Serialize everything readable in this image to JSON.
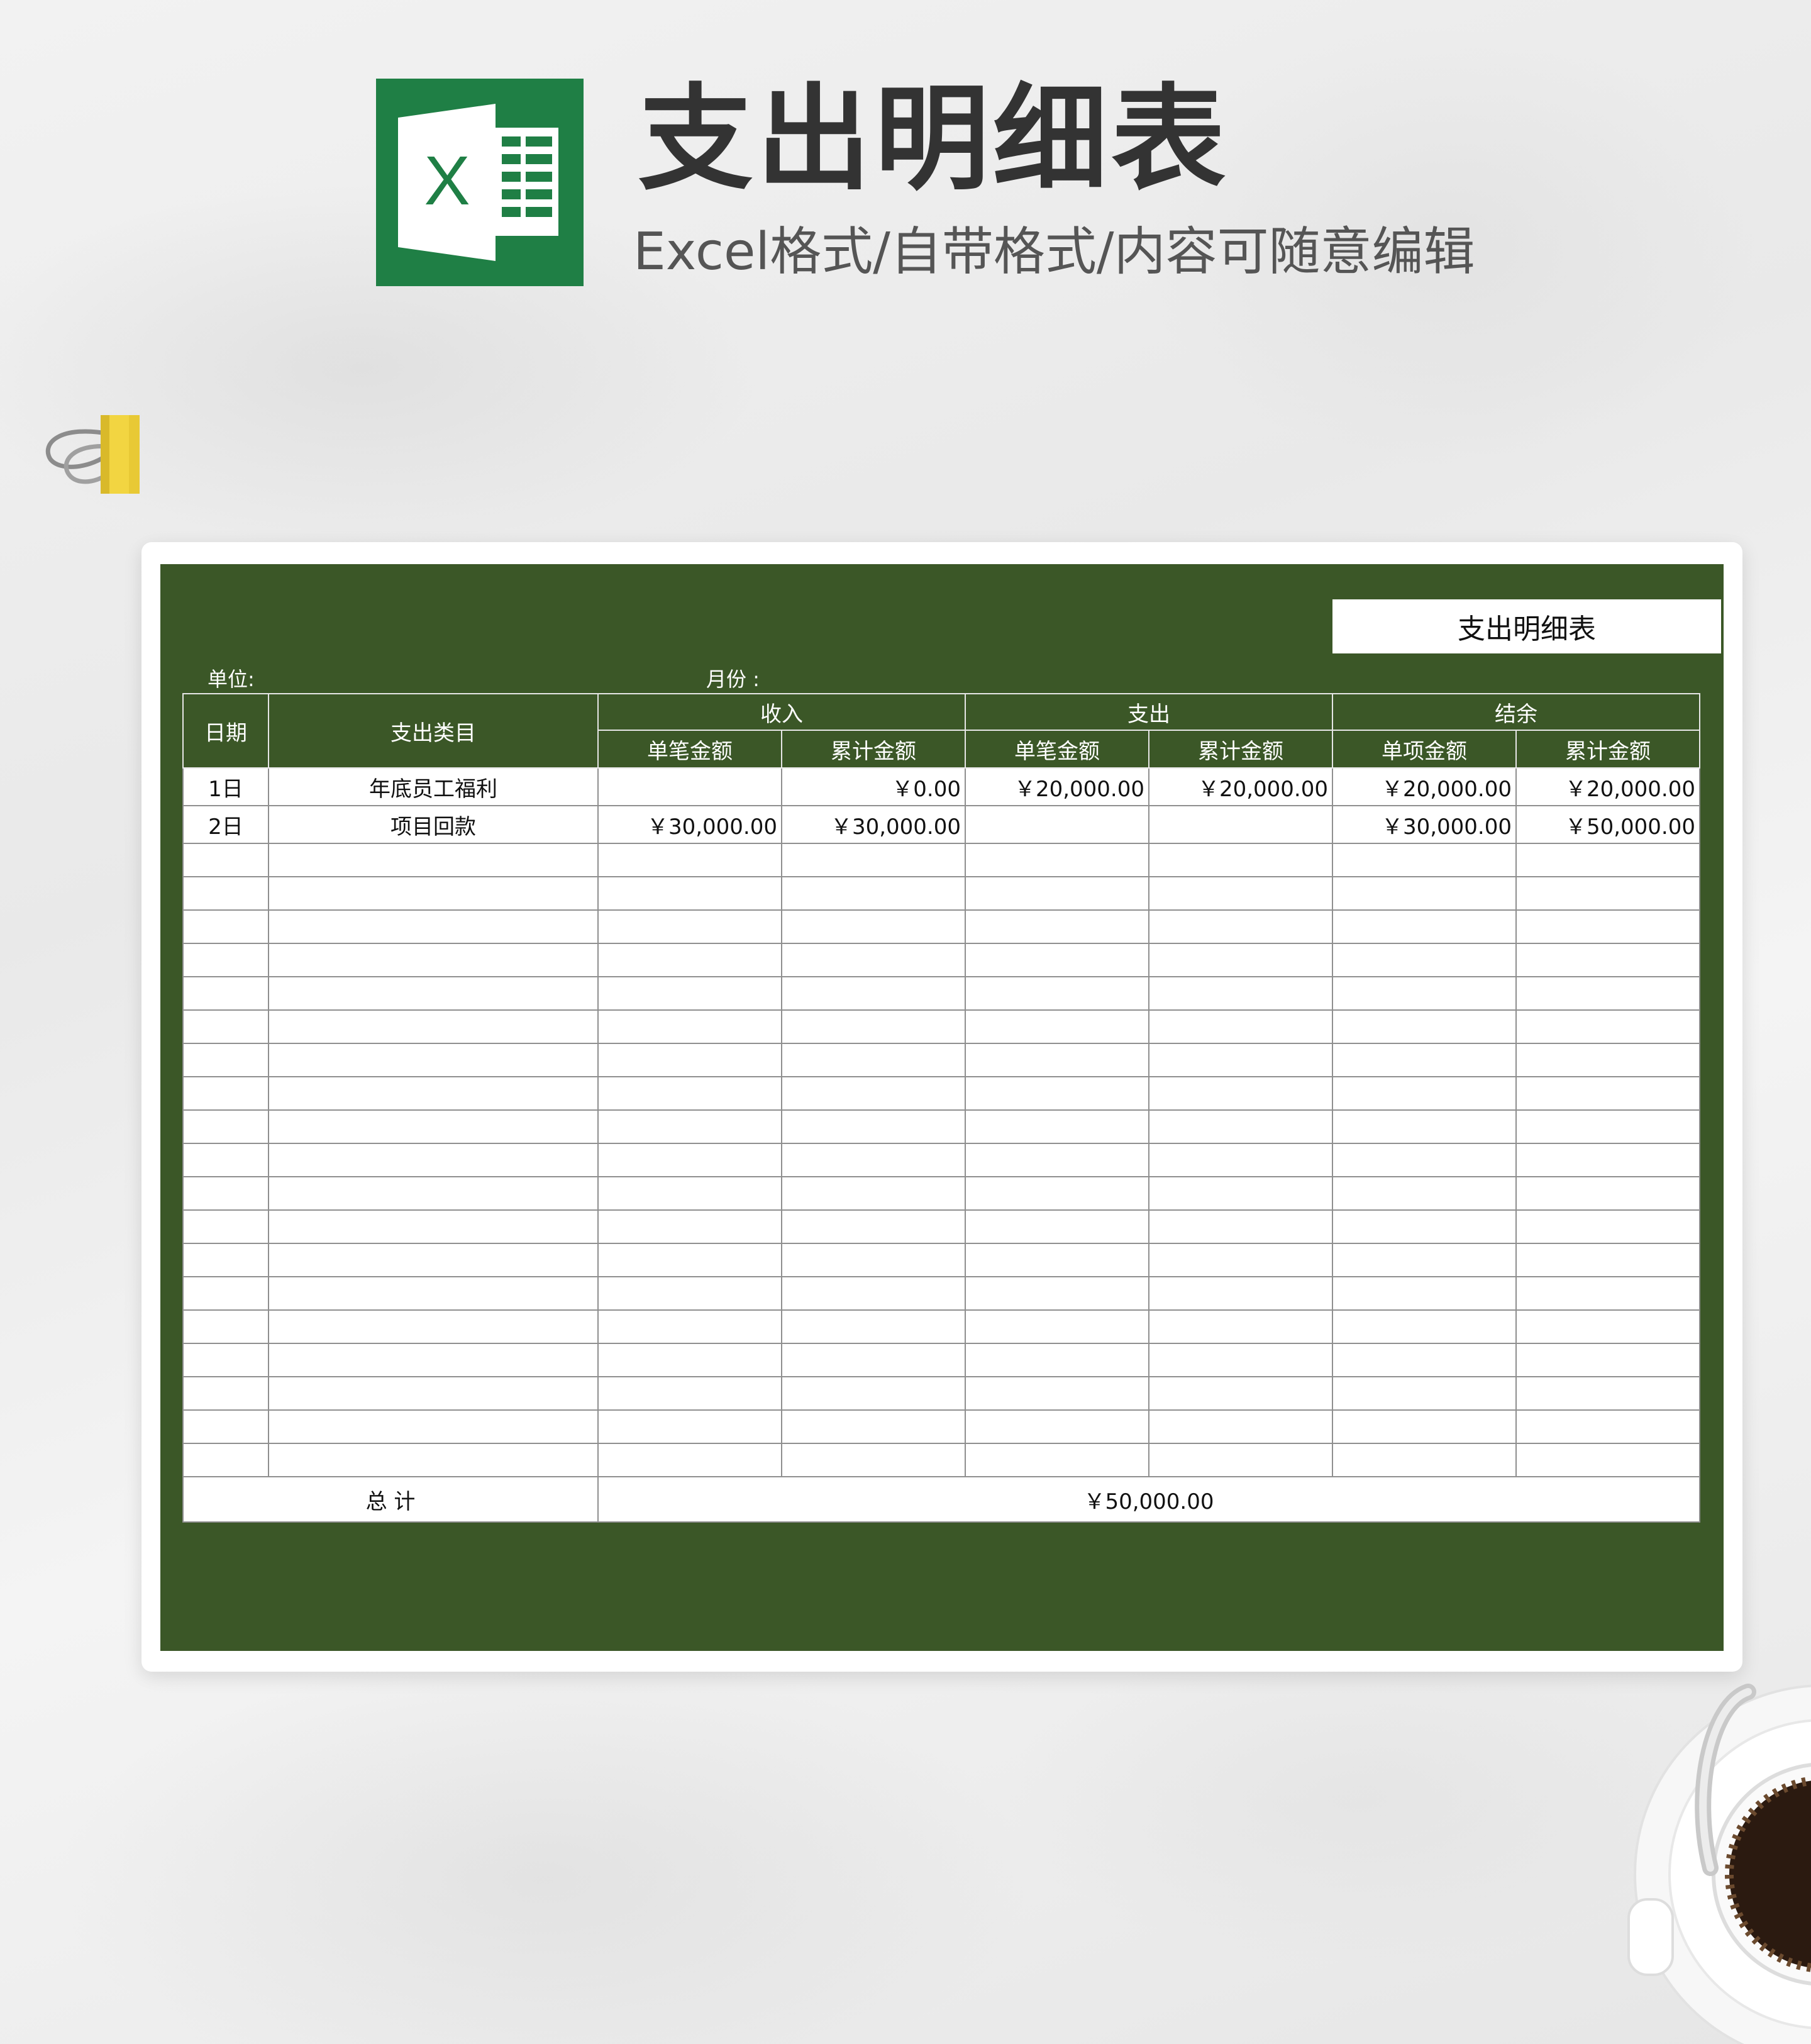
{
  "header": {
    "title": "支出明细表",
    "subtitle": "Excel格式/自带格式/内容可随意编辑",
    "logo_letter": "X"
  },
  "colors": {
    "sheet_bg": "#3b5727",
    "logo_green": "#1f7f45",
    "title_text": "#333333"
  },
  "sheet": {
    "title": "支出明细表",
    "unit_label": "单位:",
    "month_label": "月份 :"
  },
  "table": {
    "headers": {
      "date": "日期",
      "category": "支出类目",
      "income": "收入",
      "expense": "支出",
      "balance": "结余",
      "income_single": "单笔金额",
      "income_cumulative": "累计金额",
      "expense_single": "单笔金额",
      "expense_cumulative": "累计金额",
      "balance_item": "单项金额",
      "balance_cumulative": "累计金额"
    },
    "rows": [
      {
        "date": "1日",
        "category": "年底员工福利",
        "income_single": "",
        "income_cumulative": "￥0.00",
        "expense_single": "￥20,000.00",
        "expense_cumulative": "￥20,000.00",
        "balance_item": "￥20,000.00",
        "balance_cumulative": "￥20,000.00"
      },
      {
        "date": "2日",
        "category": "项目回款",
        "income_single": "￥30,000.00",
        "income_cumulative": "￥30,000.00",
        "expense_single": "",
        "expense_cumulative": "",
        "balance_item": "￥30,000.00",
        "balance_cumulative": "￥50,000.00"
      }
    ],
    "total": {
      "label": "总 计",
      "value": "￥50,000.00"
    }
  }
}
